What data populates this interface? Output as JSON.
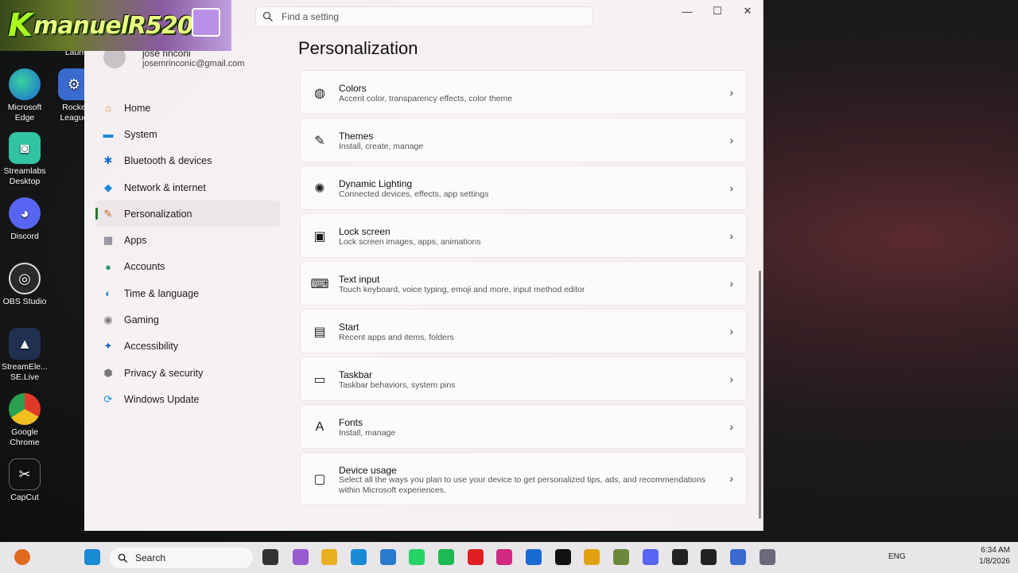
{
  "overlay_logo": {
    "text": "manuelR520",
    "k": "K"
  },
  "desktop": {
    "icons": [
      {
        "label": "Launch",
        "color": "#3b6fd6"
      },
      {
        "label": "Microsoft Edge",
        "color": "#1a8ad4"
      },
      {
        "label": "Rocke League",
        "color": "#3a6ad0"
      },
      {
        "label": "Streamlabs Desktop",
        "color": "#31c3a2"
      },
      {
        "label": "Discord",
        "color": "#5865f2"
      },
      {
        "label": "OBS Studio",
        "color": "#2a2a2a"
      },
      {
        "label": "StreamEle... SE.Live",
        "color": "#203050"
      },
      {
        "label": "Google Chrome",
        "color": "#e0a010"
      },
      {
        "label": "CapCut",
        "color": "#111111"
      }
    ]
  },
  "window": {
    "search_placeholder": "Find a setting",
    "user": {
      "name": "jose rinconi",
      "email": "josemrinconic@gmail.com"
    },
    "nav": [
      {
        "label": "Home",
        "icon": "home-icon",
        "glyph": "⌂",
        "color": "#d9822b"
      },
      {
        "label": "System",
        "icon": "monitor-icon",
        "glyph": "▬",
        "color": "#1a8ad4"
      },
      {
        "label": "Bluetooth & devices",
        "icon": "bluetooth-icon",
        "glyph": "✱",
        "color": "#1a6fd4"
      },
      {
        "label": "Network & internet",
        "icon": "wifi-icon",
        "glyph": "◆",
        "color": "#1a8ad4"
      },
      {
        "label": "Personalization",
        "icon": "brush-icon",
        "glyph": "✎",
        "color": "#c06020"
      },
      {
        "label": "Apps",
        "icon": "apps-icon",
        "glyph": "▦",
        "color": "#6a6a7a"
      },
      {
        "label": "Accounts",
        "icon": "person-icon",
        "glyph": "●",
        "color": "#2aa070"
      },
      {
        "label": "Time & language",
        "icon": "globe-icon",
        "glyph": "◐",
        "color": "#2a8ad0"
      },
      {
        "label": "Gaming",
        "icon": "gamepad-icon",
        "glyph": "◉",
        "color": "#7a7a7a"
      },
      {
        "label": "Accessibility",
        "icon": "accessibility-icon",
        "glyph": "✦",
        "color": "#1a6ad0"
      },
      {
        "label": "Privacy & security",
        "icon": "shield-icon",
        "glyph": "⬢",
        "color": "#7a7a7a"
      },
      {
        "label": "Windows Update",
        "icon": "update-icon",
        "glyph": "⟳",
        "color": "#1a8ad4"
      }
    ],
    "active_nav": "Personalization",
    "page_title": "Personalization",
    "cards": [
      {
        "title": "Colors",
        "subtitle": "Accent color, transparency effects, color theme",
        "icon": "palette-icon",
        "glyph": "◍"
      },
      {
        "title": "Themes",
        "subtitle": "Install, create, manage",
        "icon": "brush-icon",
        "glyph": "✎"
      },
      {
        "title": "Dynamic Lighting",
        "subtitle": "Connected devices, effects, app settings",
        "icon": "lighting-icon",
        "glyph": "✺"
      },
      {
        "title": "Lock screen",
        "subtitle": "Lock screen images, apps, animations",
        "icon": "lock-screen-icon",
        "glyph": "▣"
      },
      {
        "title": "Text input",
        "subtitle": "Touch keyboard, voice typing, emoji and more, input method editor",
        "icon": "keyboard-icon",
        "glyph": "⌨"
      },
      {
        "title": "Start",
        "subtitle": "Recent apps and items, folders",
        "icon": "start-icon",
        "glyph": "▤"
      },
      {
        "title": "Taskbar",
        "subtitle": "Taskbar behaviors, system pins",
        "icon": "taskbar-icon",
        "glyph": "▭"
      },
      {
        "title": "Fonts",
        "subtitle": "Install, manage",
        "icon": "fonts-icon",
        "glyph": "A"
      },
      {
        "title": "Device usage",
        "subtitle": "Select all the ways you plan to use your device to get personalized tips, ads, and recommendations within Microsoft experiences.",
        "icon": "device-usage-icon",
        "glyph": "▢"
      }
    ]
  },
  "taskbar": {
    "search_label": "Search",
    "lang": "ENG",
    "time": "6:34 AM",
    "date": "1/8/2026",
    "apps": [
      {
        "icon": "windows-start-icon",
        "color": "#1a8ad4"
      },
      {
        "icon": "file-explorer-icon",
        "color": "#333333"
      },
      {
        "icon": "copilot-icon",
        "color": "#9a5ad0"
      },
      {
        "icon": "folder-icon",
        "color": "#e8b020"
      },
      {
        "icon": "edge-icon",
        "color": "#1a8ad4"
      },
      {
        "icon": "store-icon",
        "color": "#2a7ad0"
      },
      {
        "icon": "whatsapp-icon",
        "color": "#25d366"
      },
      {
        "icon": "spotify-icon",
        "color": "#1db954"
      },
      {
        "icon": "youtube-icon",
        "color": "#e02020"
      },
      {
        "icon": "instagram-icon",
        "color": "#d02a80"
      },
      {
        "icon": "facebook-icon",
        "color": "#1a6ad4"
      },
      {
        "icon": "tiktok-icon",
        "color": "#111111"
      },
      {
        "icon": "chrome-icon",
        "color": "#e0a010"
      },
      {
        "icon": "minecraft-icon",
        "color": "#6a8a3a"
      },
      {
        "icon": "discord-icon",
        "color": "#5865f2"
      },
      {
        "icon": "obs-icon",
        "color": "#222222"
      },
      {
        "icon": "epic-games-icon",
        "color": "#222222"
      },
      {
        "icon": "rocket-league-icon",
        "color": "#3a6ad0"
      },
      {
        "icon": "settings-icon",
        "color": "#6a6a7a"
      }
    ]
  }
}
